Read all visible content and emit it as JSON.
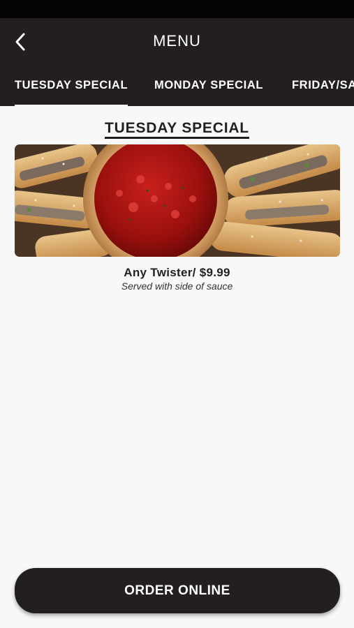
{
  "header": {
    "title": "MENU",
    "back_icon": "chevron-left-icon"
  },
  "tabs": [
    {
      "label": "TUESDAY SPECIAL",
      "active": true
    },
    {
      "label": "MONDAY SPECIAL",
      "active": false
    },
    {
      "label": "FRIDAY/SA",
      "active": false
    }
  ],
  "content": {
    "title": "TUESDAY SPECIAL",
    "image": "calzone-twisters-with-marinara-dip",
    "item_name": "Any Twister/ $9.99",
    "item_description": "Served with side of sauce"
  },
  "footer": {
    "order_label": "ORDER ONLINE"
  },
  "colors": {
    "header_bg": "#231f20",
    "page_bg": "#f8f8f8",
    "text_dark": "#231f20"
  }
}
